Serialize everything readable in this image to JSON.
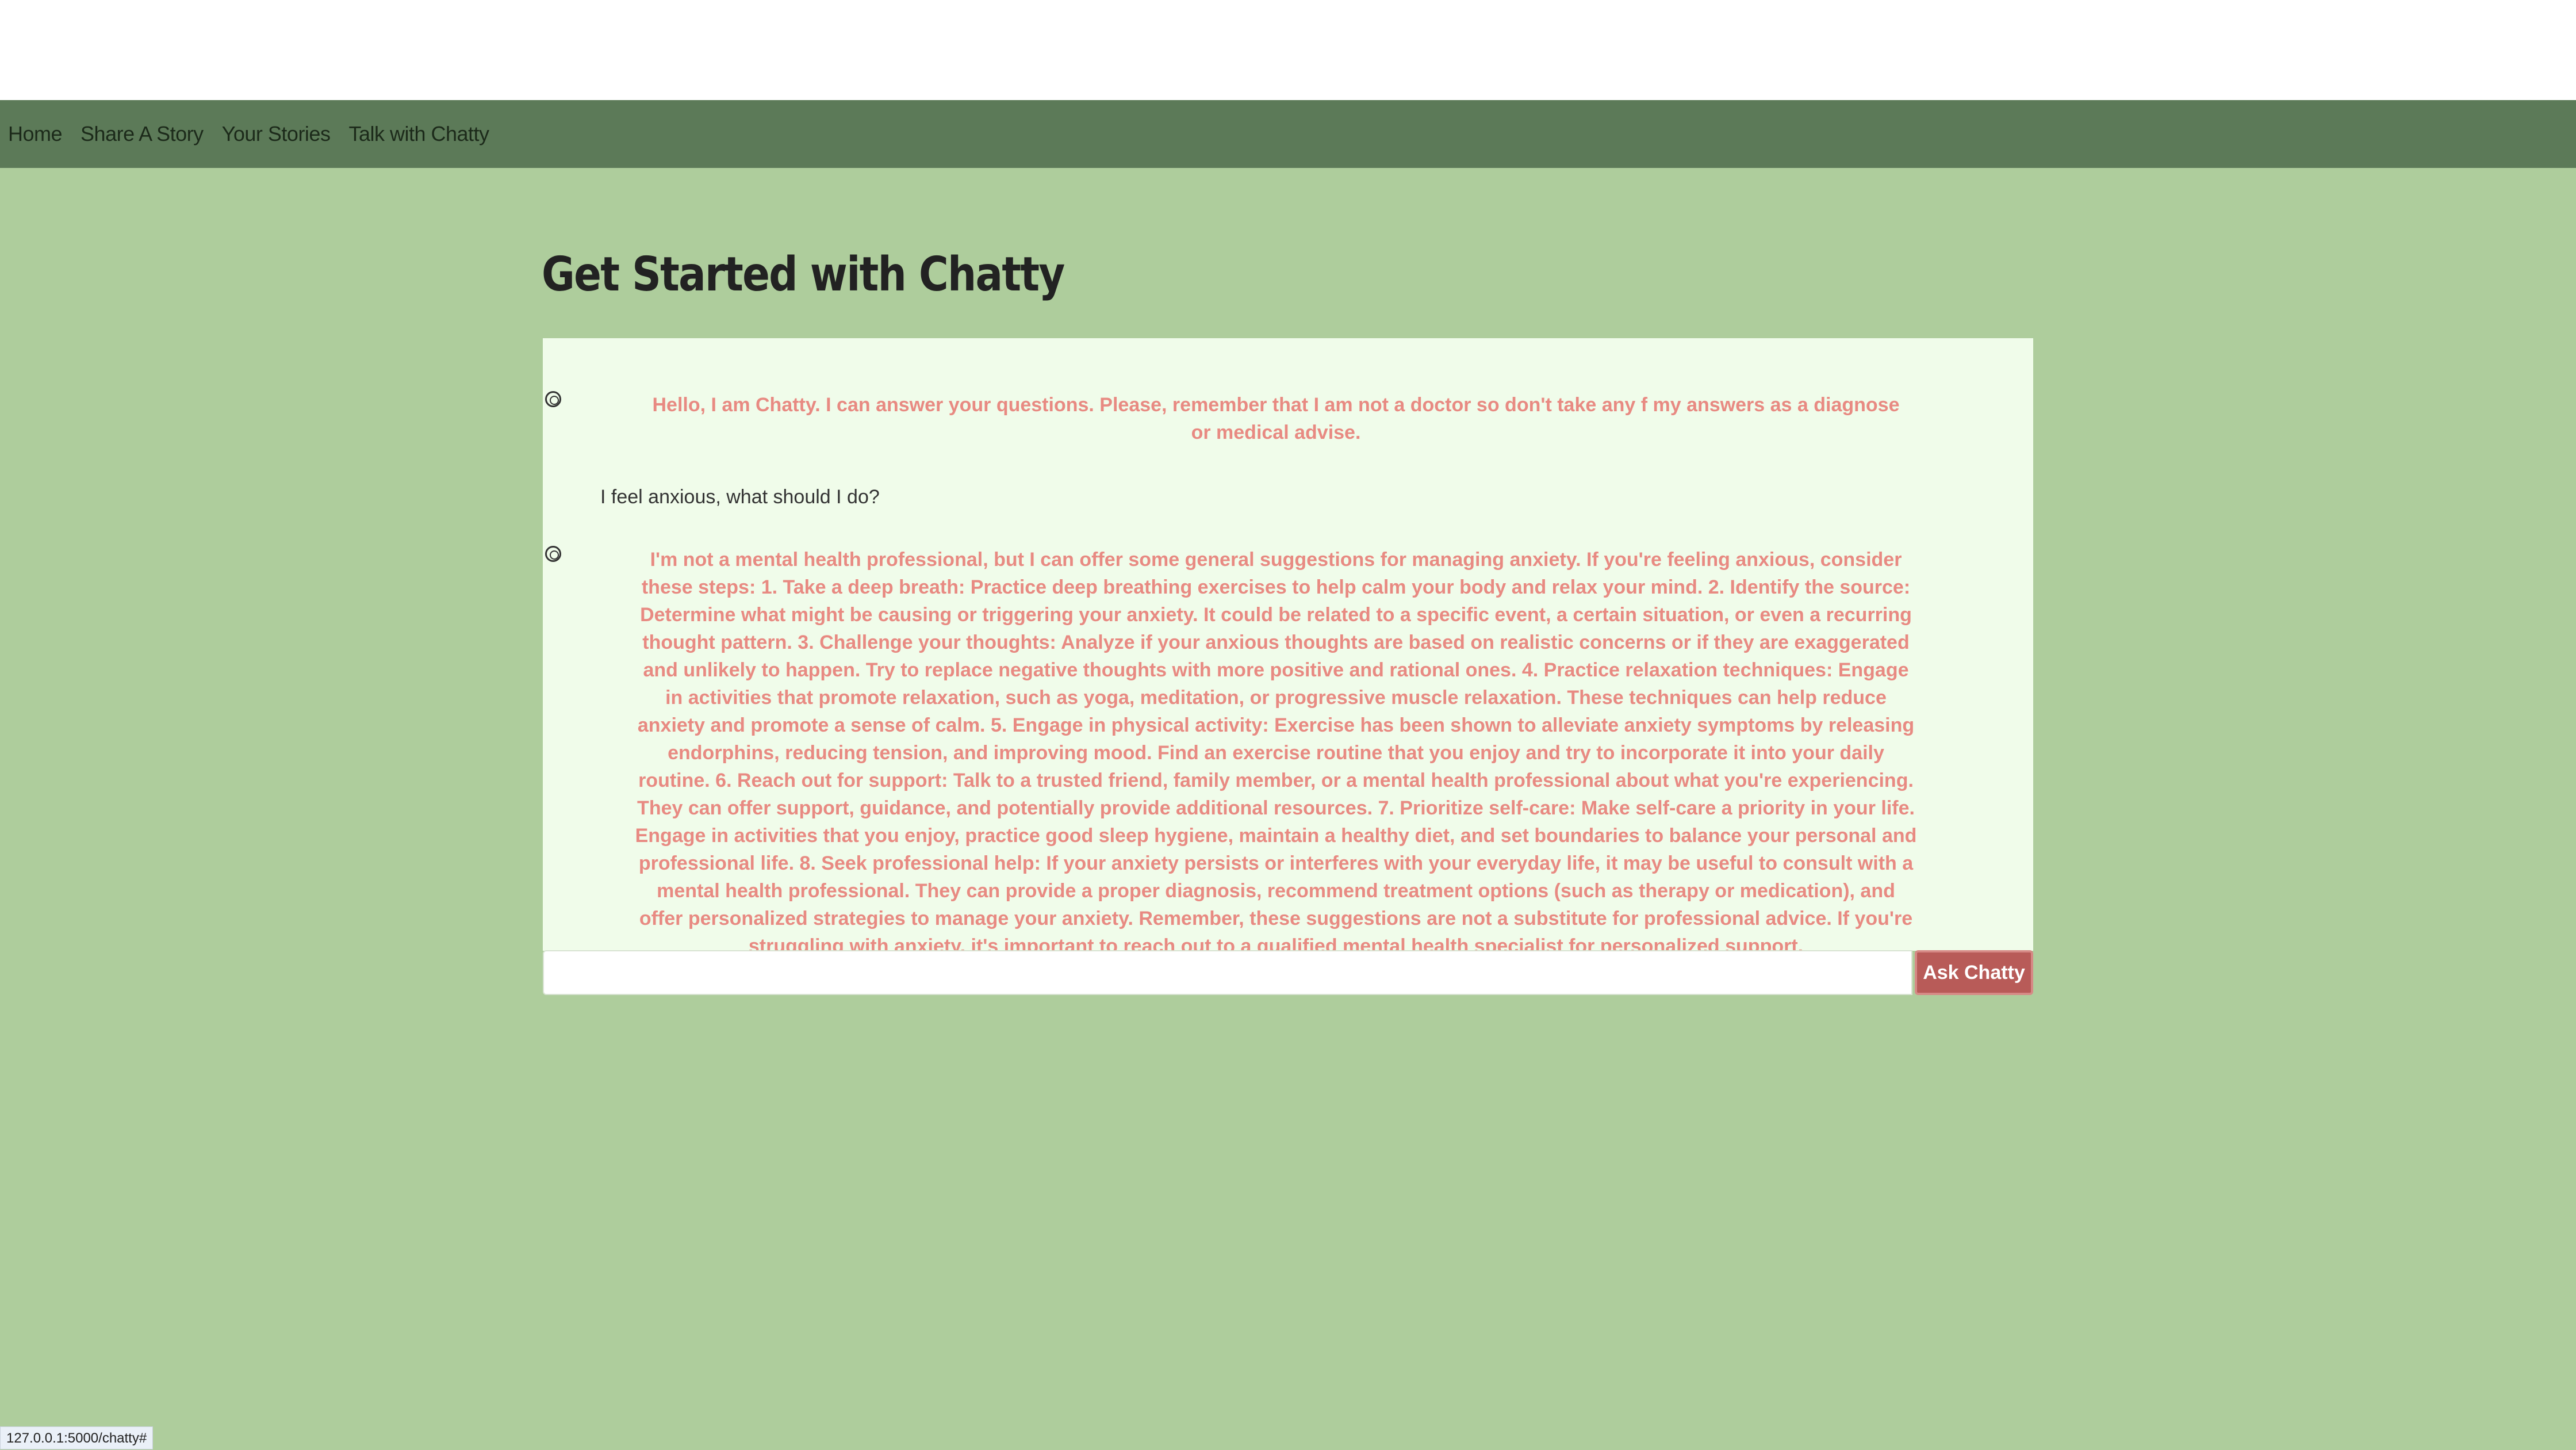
{
  "nav": {
    "items": [
      {
        "label": "Home"
      },
      {
        "label": "Share A Story"
      },
      {
        "label": "Your Stories"
      },
      {
        "label": "Talk with Chatty"
      }
    ]
  },
  "page": {
    "title": "Get Started with Chatty"
  },
  "chat": {
    "messages": [
      {
        "role": "bot",
        "icon": "openai-logo-icon",
        "text": "Hello, I am Chatty. I can answer your questions. Please, remember that I am not a doctor so don't take any f my answers as a diagnose or medical advise."
      },
      {
        "role": "user",
        "text": "I feel anxious, what should I do?"
      },
      {
        "role": "bot",
        "icon": "openai-logo-icon",
        "text": "I'm not a mental health professional, but I can offer some general suggestions for managing anxiety. If you're feeling anxious, consider these steps: 1. Take a deep breath: Practice deep breathing exercises to help calm your body and relax your mind. 2. Identify the source: Determine what might be causing or triggering your anxiety. It could be related to a specific event, a certain situation, or even a recurring thought pattern. 3. Challenge your thoughts: Analyze if your anxious thoughts are based on realistic concerns or if they are exaggerated and unlikely to happen. Try to replace negative thoughts with more positive and rational ones. 4. Practice relaxation techniques: Engage in activities that promote relaxation, such as yoga, meditation, or progressive muscle relaxation. These techniques can help reduce anxiety and promote a sense of calm. 5. Engage in physical activity: Exercise has been shown to alleviate anxiety symptoms by releasing endorphins, reducing tension, and improving mood. Find an exercise routine that you enjoy and try to incorporate it into your daily routine. 6. Reach out for support: Talk to a trusted friend, family member, or a mental health professional about what you're experiencing. They can offer support, guidance, and potentially provide additional resources. 7. Prioritize self-care: Make self-care a priority in your life. Engage in activities that you enjoy, practice good sleep hygiene, maintain a healthy diet, and set boundaries to balance your personal and professional life. 8. Seek professional help: If your anxiety persists or interferes with your everyday life, it may be useful to consult with a mental health professional. They can provide a proper diagnosis, recommend treatment options (such as therapy or medication), and offer personalized strategies to manage your anxiety. Remember, these suggestions are not a substitute for professional advice. If you're struggling with anxiety, it's important to reach out to a qualified mental health specialist for personalized support."
      }
    ],
    "input": {
      "value": "",
      "placeholder": ""
    },
    "ask_button_label": "Ask Chatty"
  },
  "status_bar": {
    "url": "127.0.0.1:5000/chatty#"
  },
  "colors": {
    "background": "#aecd9c",
    "navbar": "#5c7a58",
    "chat_panel": "#f0fcea",
    "bot_text": "#e88a82",
    "button": "#b85b58"
  }
}
